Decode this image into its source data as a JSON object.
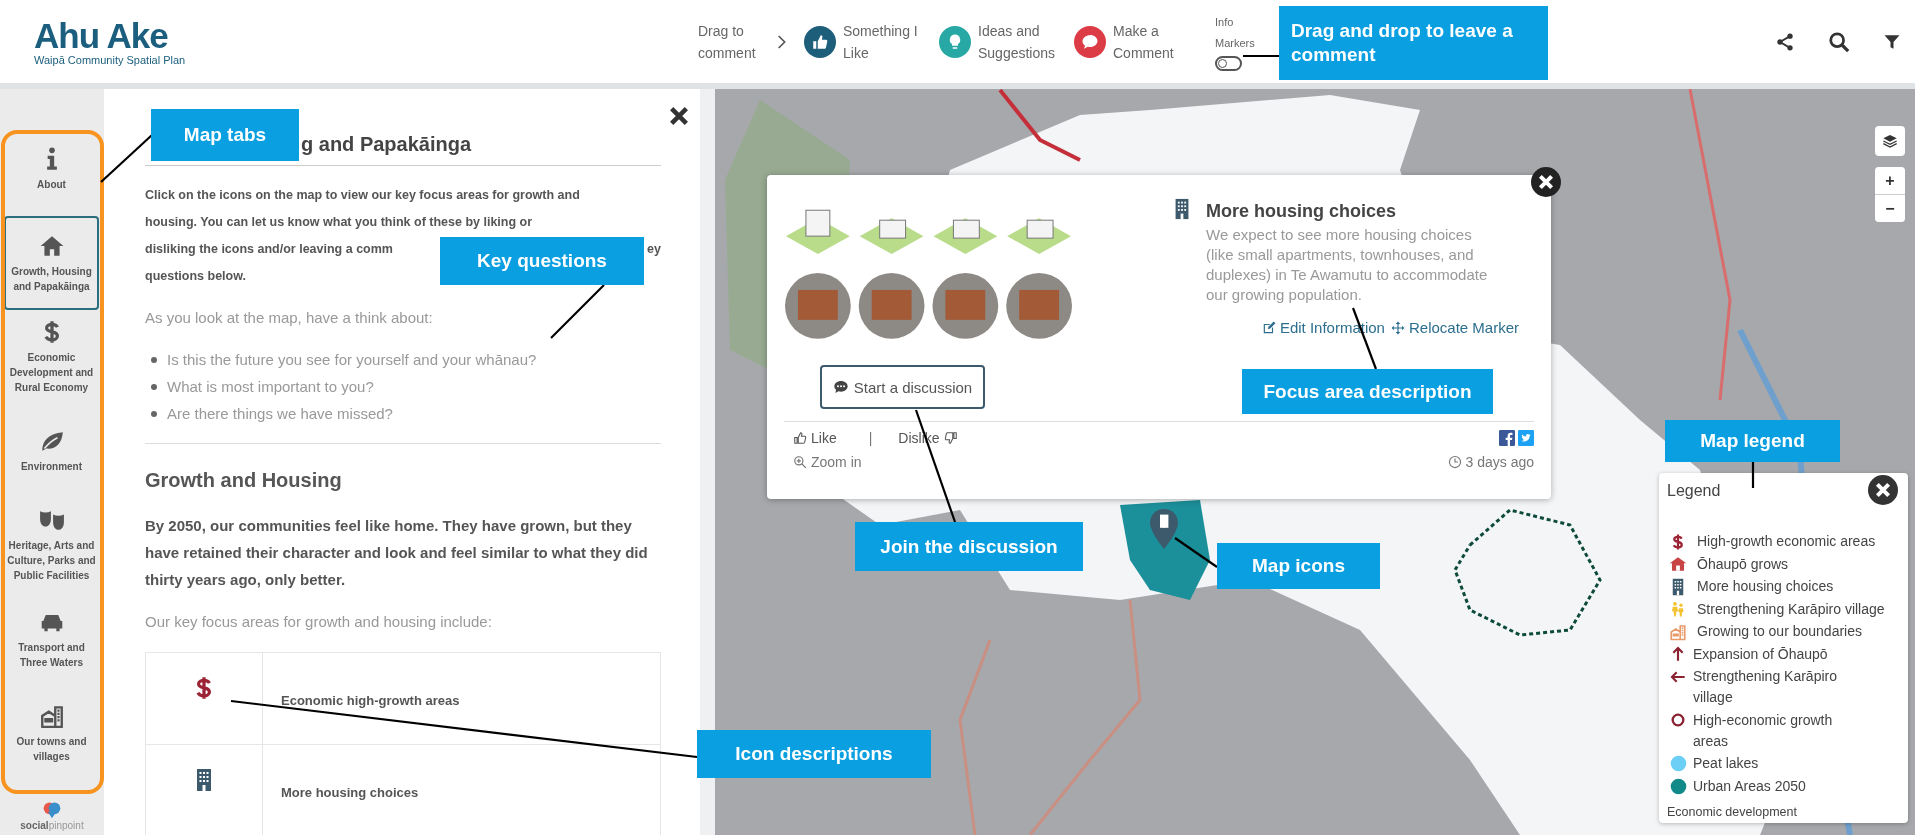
{
  "header": {
    "logo": {
      "title": "Ahu Ake",
      "subtitle": "Waipā Community Spatial Plan"
    },
    "drag_hint": "Drag to comment",
    "markers": [
      {
        "kind": "like",
        "label": "Something I Like",
        "color": "#1d5f7a"
      },
      {
        "kind": "idea",
        "label": "Ideas and Suggestions",
        "color": "#27a8a5"
      },
      {
        "kind": "comment",
        "label": "Make a Comment",
        "color": "#dc3c45"
      }
    ],
    "info_markers": {
      "label": "Info Markers",
      "on": false
    }
  },
  "sidebar": {
    "tabs": [
      {
        "kind": "info",
        "label": "About",
        "selected": false
      },
      {
        "kind": "home",
        "label": "Growth, Housing and Papakāinga",
        "selected": true
      },
      {
        "kind": "dollar",
        "label": "Economic Development and Rural Economy",
        "selected": false
      },
      {
        "kind": "leaf",
        "label": "Environment",
        "selected": false
      },
      {
        "kind": "masks",
        "label": "Heritage, Arts and Culture, Parks and Public Facilities",
        "selected": false
      },
      {
        "kind": "car",
        "label": "Transport and Three Waters",
        "selected": false
      },
      {
        "kind": "towns",
        "label": "Our towns and villages",
        "selected": false
      }
    ],
    "footer_logo": "**social**pinpoint"
  },
  "panel": {
    "title": "g and Papakāinga",
    "intro_lines": [
      [
        "Click on the icons on the map to view our key focus areas for growth and"
      ],
      [
        "housing. You can let us know what you think of these by liking or"
      ],
      [
        "disliking the icons and/or leaving a comm",
        "ey"
      ],
      [
        "questions below."
      ]
    ],
    "prompt": "As you look at the map, have a think about:",
    "questions": [
      "Is this the future you see for yourself and your whānau?",
      "What is most important to you?",
      "Are there things we have missed?"
    ],
    "section_title": "Growth and Housing",
    "vision": "By 2050, our communities feel like home. They have grown, but they have retained their character and look and feel similar to what they did thirty years ago, only better.",
    "focus_intro": "Our key focus areas for growth and housing include:",
    "focus_areas": [
      {
        "kind": "dollar",
        "color": "#9b2335",
        "label": "Economic high-growth areas"
      },
      {
        "kind": "building",
        "color": "#3d5a6c",
        "label": "More housing choices"
      }
    ]
  },
  "map": {
    "zoom_in": "+",
    "zoom_out": "−",
    "popup": {
      "title": "More housing choices",
      "description": "We expect to see more housing choices (like small apartments, townhouses, and duplexes) in Te Awamutu to accommodate our growing population.",
      "links": [
        "Edit Information",
        "Relocate Marker"
      ],
      "discussion_button": "Start a discussion",
      "like": "Like",
      "separator": "|",
      "dislike": "Dislike",
      "zoom": "Zoom in",
      "age": "3 days ago"
    },
    "legend": {
      "title": "Legend",
      "items": [
        {
          "kind": "dollar",
          "color": "#9b2335",
          "label": "High-growth economic areas"
        },
        {
          "kind": "house",
          "color": "#c94545",
          "label": "Ōhaupō grows"
        },
        {
          "kind": "building",
          "color": "#3d5a6c",
          "label": "More housing choices"
        },
        {
          "kind": "people",
          "color": "#f2c230",
          "label": "Strengthening Karāpiro village"
        },
        {
          "kind": "towns",
          "color": "#e99a6a",
          "label": "Growing to our boundaries"
        },
        {
          "kind": "arrow-up",
          "color": "#8b2232",
          "label": "Expansion of Ōhaupō"
        },
        {
          "kind": "arrow-left",
          "color": "#8b2232",
          "label": "Strengthening Karāpiro village"
        },
        {
          "kind": "ring",
          "color": "#8b2232",
          "label": "High-economic growth areas"
        },
        {
          "kind": "dot",
          "color": "#6ccff6",
          "label": "Peat lakes"
        },
        {
          "kind": "dot",
          "color": "#138a8a",
          "label": "Urban Areas 2050"
        }
      ],
      "footer": "Economic development"
    }
  },
  "annotations": [
    "Drag and drop to leave a comment",
    "Map tabs",
    "Key questions",
    "Focus area description",
    "Map legend",
    "Join the discussion",
    "Map icons",
    "Icon descriptions"
  ]
}
